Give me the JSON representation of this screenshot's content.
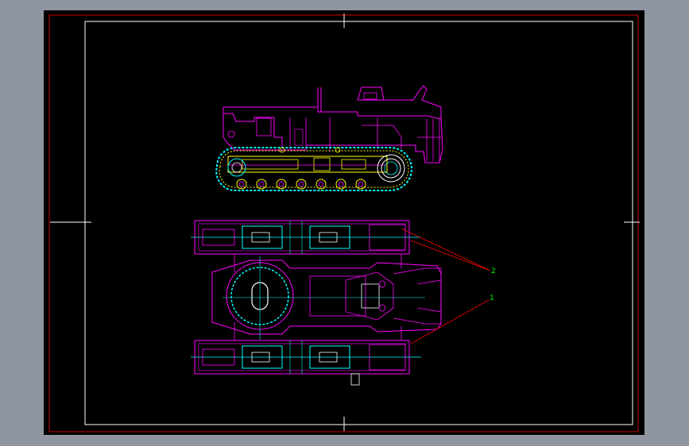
{
  "drawing": {
    "title": "",
    "background": "#000000",
    "page_background": "#8f96a1",
    "colors": {
      "frame": "#cc0000",
      "inner_border": "#ffffff",
      "magenta": "#ff00ff",
      "cyan": "#00ffff",
      "yellow": "#ffff00",
      "green": "#00ff00",
      "white": "#ffffff",
      "leader": "#ff0000",
      "label_green": "#00ff00",
      "label_yellow": "#ffff00"
    },
    "callouts": [
      {
        "id": "1",
        "text": "1"
      },
      {
        "id": "2",
        "text": "2"
      }
    ],
    "views": [
      {
        "name": "side-elevation"
      },
      {
        "name": "top-plan"
      }
    ]
  }
}
